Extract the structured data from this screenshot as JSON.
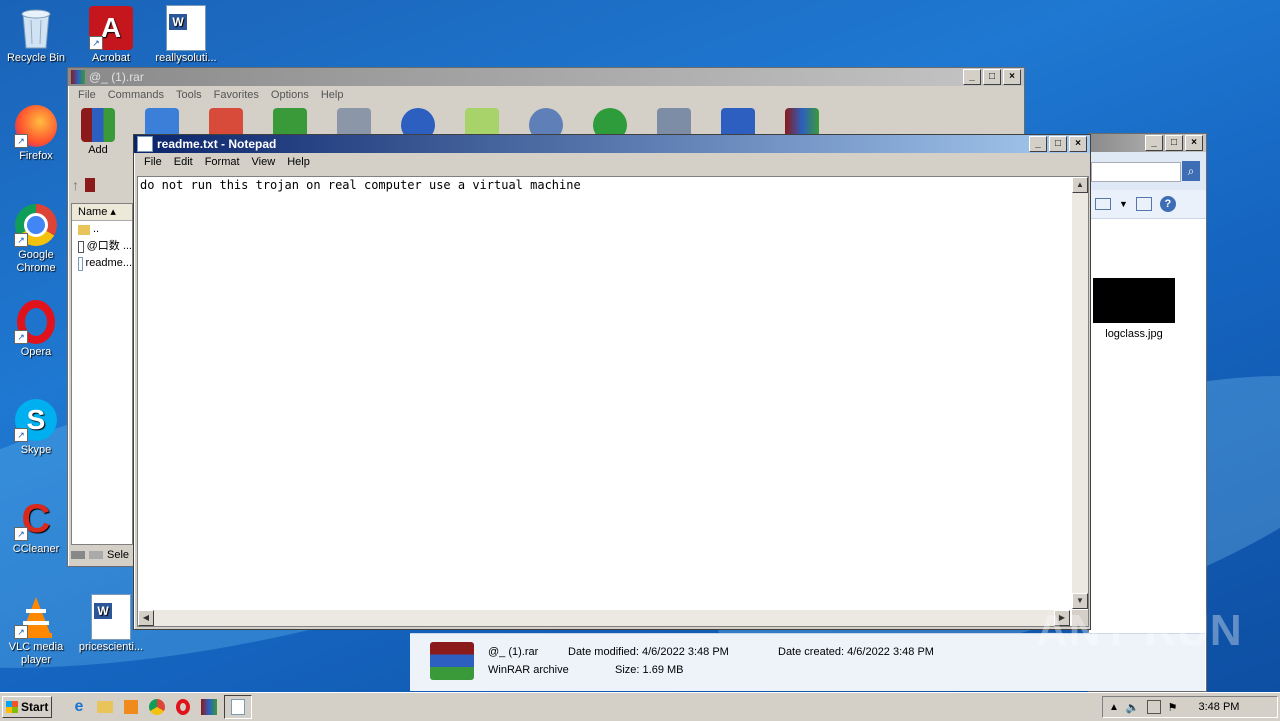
{
  "desktop": {
    "icons": [
      {
        "label": "Recycle Bin",
        "icon": "recycle-bin-icon"
      },
      {
        "label": "Acrobat",
        "icon": "acrobat-icon"
      },
      {
        "label": "reallysoluti...",
        "icon": "word-document-icon"
      },
      {
        "label": "Firefox",
        "icon": "firefox-icon"
      },
      {
        "label": "Google Chrome",
        "icon": "chrome-icon"
      },
      {
        "label": "Opera",
        "icon": "opera-icon"
      },
      {
        "label": "Skype",
        "icon": "skype-icon"
      },
      {
        "label": "CCleaner",
        "icon": "ccleaner-icon"
      },
      {
        "label": "VLC media player",
        "icon": "vlc-icon"
      },
      {
        "label": "pricescienti...",
        "icon": "word-document-icon"
      }
    ]
  },
  "winrar": {
    "title": "@_ (1).rar",
    "menu": [
      "File",
      "Commands",
      "Tools",
      "Favorites",
      "Options",
      "Help"
    ],
    "toolbar_add_label": "Add",
    "list_header": "Name",
    "rows": [
      "..",
      "@口数 ...",
      "readme..."
    ],
    "status": "Sele"
  },
  "notepad": {
    "title": "readme.txt - Notepad",
    "menu": [
      "File",
      "Edit",
      "Format",
      "View",
      "Help"
    ],
    "content": "do not run this trojan on real computer use a virtual machine"
  },
  "explorer": {
    "file_label": "logclass.jpg",
    "details": {
      "name": "@_ (1).rar",
      "type": "WinRAR archive",
      "date_modified_label": "Date modified:",
      "date_modified": "4/6/2022 3:48 PM",
      "size_label": "Size:",
      "size": "1.69 MB",
      "date_created_label": "Date created:",
      "date_created": "4/6/2022 3:48 PM"
    }
  },
  "taskbar": {
    "start_label": "Start",
    "clock": "3:48 PM"
  },
  "watermark": "ANY RUN",
  "colors": {
    "desktop": "#1f78d1",
    "title_active": "#0a246a",
    "title_inactive": "#8a8a8a"
  }
}
